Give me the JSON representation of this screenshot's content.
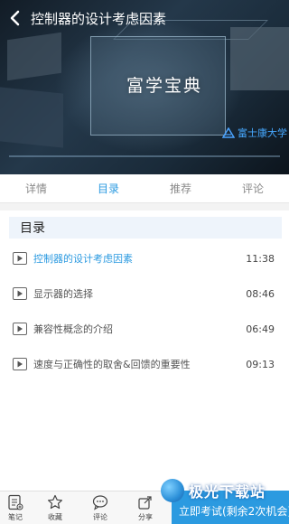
{
  "header": {
    "title": "控制器的设计考虑因素"
  },
  "video": {
    "brand_text": "富学宝典",
    "logo_text": "富士康大学"
  },
  "tabs": [
    {
      "label": "详情"
    },
    {
      "label": "目录"
    },
    {
      "label": "推荐"
    },
    {
      "label": "评论"
    }
  ],
  "active_tab": "目录",
  "catalog": {
    "heading": "目录",
    "lessons": [
      {
        "title": "控制器的设计考虑因素",
        "duration": "11:38"
      },
      {
        "title": "显示器的选择",
        "duration": "08:46"
      },
      {
        "title": "兼容性概念的介绍",
        "duration": "06:49"
      },
      {
        "title": "速度与正确性的取舍&回馈的重要性",
        "duration": "09:13"
      }
    ]
  },
  "toolbar": {
    "note_label": "笔记",
    "favorite_label": "收藏",
    "comment_label": "评论",
    "share_label": "分享",
    "exam_label": "立即考试(剩余2次机会)"
  },
  "watermark": {
    "text": "极光下载站"
  },
  "colors": {
    "accent": "#2b9ae0",
    "catalog_head_bg": "#eef4fb"
  },
  "icons": [
    "back-arrow-icon",
    "play-icon",
    "note-icon",
    "star-icon",
    "comment-icon",
    "share-icon"
  ]
}
